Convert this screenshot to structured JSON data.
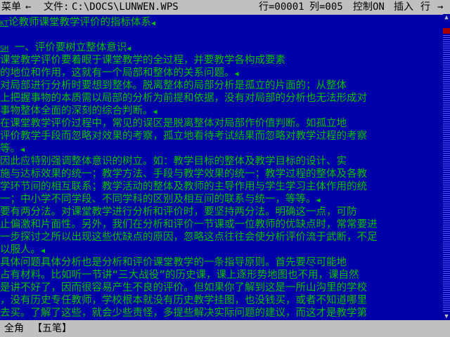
{
  "topbar": {
    "menu": "菜单",
    "file_label": "文件:",
    "file_path": "C:\\DOCS\\LUNWEN.WPS",
    "row": "行=00001",
    "col": "列=005",
    "control": "控制ON",
    "insert": "插入",
    "row_label": "行"
  },
  "document": {
    "lines": [
      {
        "ctrl": "KT",
        "text": "论教师课堂教学评价的指标体系",
        "end": "◀"
      },
      {
        "ctrl": "",
        "text": "",
        "end": ""
      },
      {
        "ctrl": "SH",
        "text": "    一、评价要树立整体意识",
        "end": "◀"
      },
      {
        "ctrl": "",
        "text": "    课堂教学评价要着眼于课堂教学的全过程，并要教学各构成要素",
        "end": ""
      },
      {
        "ctrl": "",
        "text": "的地位和作用，这就有一个局部和整体的关系问题。",
        "end": "◀"
      },
      {
        "ctrl": "",
        "text": "    对局部进行分析时要想到整体。脱离整体的局部分析是孤立的片面的；从整体",
        "end": ""
      },
      {
        "ctrl": "",
        "text": "上把握事物的本质需以局部的分析为前提和依据，没有对局部的分析也无法形成对",
        "end": ""
      },
      {
        "ctrl": "",
        "text": "事物整体全面的深刻的综合判断。",
        "end": "◀"
      },
      {
        "ctrl": "",
        "text": "    在课堂教学评价过程中，常见的误区是脱离整体对局部作价值判断。如孤立地",
        "end": ""
      },
      {
        "ctrl": "",
        "text": "评价教学手段而忽略对效果的考察，孤立地看待考试结果而忽略对教学过程的考察",
        "end": ""
      },
      {
        "ctrl": "",
        "text": "等。",
        "end": "◀"
      },
      {
        "ctrl": "",
        "text": "    因此应特别强调整体意识的树立。如：教学目标的整体及教学目标的设计、实",
        "end": ""
      },
      {
        "ctrl": "",
        "text": "施与达标效果的统一；教学方法、手段与教学效果的统一；教学过程的整体及各教",
        "end": ""
      },
      {
        "ctrl": "",
        "text": "学环节间的相互联系；教学活动的整体及教师的主导作用与学生学习主体作用的统",
        "end": ""
      },
      {
        "ctrl": "",
        "text": "一；中小学不同学段、不同学科的区别及相互间的联系与统一，等等。",
        "end": "◀"
      },
      {
        "ctrl": "",
        "text": "    要有两分法。对课堂教学进行分析和评价时，要坚持两分法。明确这一点，可防",
        "end": ""
      },
      {
        "ctrl": "",
        "text": "止偏激和片面性。另外，我们在分析和评价一节课或一位教师的优缺点时，常常要进",
        "end": ""
      },
      {
        "ctrl": "",
        "text": "一步探讨之所以出现这些优缺点的原因，忽略这点往往会使分析评价流于武断，不足",
        "end": ""
      },
      {
        "ctrl": "",
        "text": "以服人。",
        "end": "◀"
      },
      {
        "ctrl": "",
        "text": "    具体问题具体分析也是分析和评价课堂教学的一条指导原则。首先要尽可能地",
        "end": ""
      },
      {
        "ctrl": "",
        "text": "占有材料。比如听一节讲“三大战役”的历史课，课上逐形势地图也不用，课自然",
        "end": ""
      },
      {
        "ctrl": "",
        "text": "是讲不好了，因而很容易产生不良的评价。但如果你了解到这是一所山沟里的学校",
        "end": ""
      },
      {
        "ctrl": "",
        "text": "，没有历史专任教师，学校根本就没有历史教学挂图，也没钱买，或者不知道哪里",
        "end": ""
      },
      {
        "ctrl": "",
        "text": "去买。了解了这些，就会少些责怪，多提些解决实际问题的建议，而这才是教学第",
        "end": ""
      }
    ]
  },
  "statusbar": {
    "mode": "全角",
    "ime": "【五笔】"
  },
  "scrollbar": {
    "up_icon": "▲",
    "down_icon": "▼"
  },
  "colors": {
    "background": "#0000a8",
    "text": "#00c000",
    "bar": "#c0c0c0",
    "thumb": "#a80000"
  }
}
